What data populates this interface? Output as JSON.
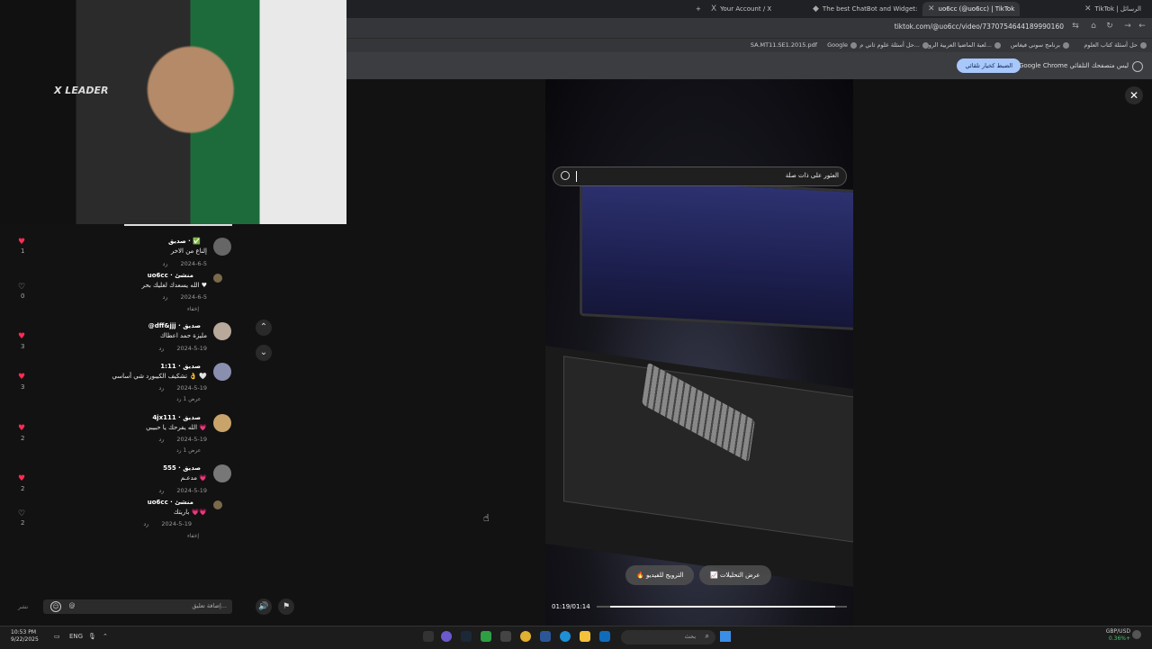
{
  "browser": {
    "tabs": [
      {
        "label": "TikTok | الرسائل",
        "active": false
      },
      {
        "label": "uo6cc (@uo6cc) | TikTok",
        "active": true
      },
      {
        "label": "The best ChatBot and Widget:",
        "active": false
      },
      {
        "label": "Your Account / X",
        "active": false
      }
    ],
    "new_tab": "+",
    "url": "tiktok.com/@uo6cc/video/7370754644189990160",
    "bookmarks": [
      "حل أسئلة كتاب العلوم",
      "برنامج سوني فيغاس",
      "لعبة الماضيا العربية الرو...",
      "حل أسئلة علوم ثاني م...",
      "Google",
      "SA.MT11.SE1.2015.pdf"
    ],
    "infobar": {
      "text": "Google Chrome ليس متصفحك التلقائي",
      "button": "الضبط كخيار تلقائي"
    }
  },
  "webcam": {
    "label": "X LEADER"
  },
  "comments": [
    {
      "name": "صديق · ✅",
      "text": "إلناع من الاخر",
      "date": "2024-6-5",
      "reply": "رد",
      "likes": "1",
      "liked": true
    },
    {
      "name": "uo6cc · منشئ",
      "text": "الله يسعدك لغليك بحر ♥",
      "date": "2024-6-5",
      "reply": "رد",
      "likes": "0",
      "liked": false,
      "nested": true
    },
    {
      "name": "@dff&jjj · صديق",
      "text": "مليزة حمد اعطاك",
      "date": "2024-5-19",
      "reply": "رد",
      "likes": "3",
      "liked": true
    },
    {
      "name": "1:11 · صديق",
      "text": "تشكيف الكيبورد شي أساسي 👌 🤍",
      "date": "2024-5-19",
      "reply": "رد",
      "likes": "3",
      "liked": true
    },
    {
      "name": "4jx111 · صديق",
      "text": "الله يفرحك يا حبيبي 💗",
      "date": "2024-5-19",
      "reply": "رد",
      "likes": "2",
      "liked": true
    },
    {
      "name": "555 · صديق",
      "text": "مدعـم 💗",
      "date": "2024-5-19",
      "reply": "رد",
      "likes": "2",
      "liked": true
    },
    {
      "name": "uo6cc · منشئ",
      "text": "باريتك 💗💗",
      "date": "2024-5-19",
      "reply": "رد",
      "likes": "2",
      "liked": false,
      "nested": true
    }
  ],
  "expand_labels": {
    "hide": "إخفاء",
    "view_one": "عرض 1 رد"
  },
  "comment_input": {
    "placeholder": "إضافة تعليق...",
    "post": "نشر"
  },
  "video": {
    "search_text": "العثور على ذات صلة",
    "analytics_button": "عرض التحليلات",
    "promote_button": "الترويج للفيديو",
    "timecode": "01:19/01:14",
    "progress": 0.95
  },
  "icons": {
    "close": "✕",
    "up": "⌃",
    "down": "⌄",
    "mute": "🔊",
    "flag": "⚑",
    "emoji": "☺",
    "at": "@"
  },
  "taskbar": {
    "time": "10:53 PM",
    "date": "9/22/2025",
    "lang": "ENG",
    "search": "بحث",
    "currency_pair": "GBP/USD",
    "currency_change": "0.36%+"
  }
}
